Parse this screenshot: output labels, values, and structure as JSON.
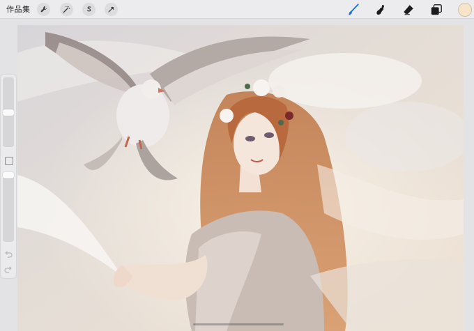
{
  "toolbar": {
    "gallery_label": "作品集",
    "left_tools": [
      {
        "name": "actions-wrench",
        "icon": "wrench-icon"
      },
      {
        "name": "adjustments-magic-wand",
        "icon": "magic-wand-icon"
      },
      {
        "name": "selection",
        "icon": "selection-s-icon"
      },
      {
        "name": "transform-arrow",
        "icon": "arrow-cursor-icon"
      }
    ],
    "right_tools": [
      {
        "name": "brush",
        "icon": "brush-icon",
        "active": true
      },
      {
        "name": "smudge",
        "icon": "smudge-icon"
      },
      {
        "name": "eraser",
        "icon": "eraser-icon"
      },
      {
        "name": "layers",
        "icon": "layers-icon"
      }
    ],
    "current_color": "#f8e4c8"
  },
  "sidebar": {
    "brush_size_level": 0.5,
    "opacity_level": 0.0,
    "undo_icon": "undo-icon",
    "redo_icon": "redo-icon"
  },
  "colors": {
    "accent": "#1a6fe0",
    "toolbar_bg": "#ececee"
  }
}
